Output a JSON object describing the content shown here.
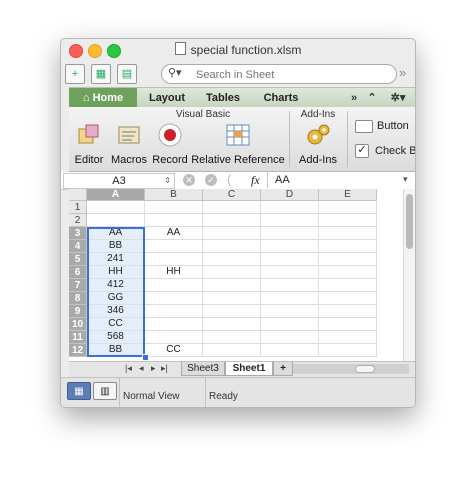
{
  "window": {
    "title": "special function.xlsm"
  },
  "toolbar": {
    "search_placeholder": "Search in Sheet"
  },
  "tabs": [
    "Home",
    "Layout",
    "Tables",
    "Charts"
  ],
  "tabs_more": "»",
  "ribbon": {
    "group_vb": "Visual Basic",
    "group_addins": "Add-Ins",
    "editor": "Editor",
    "macros": "Macros",
    "record": "Record",
    "relative_reference": "Relative Reference",
    "add_ins": "Add-Ins",
    "button": "Button",
    "check_box": "Check Bo"
  },
  "formula_bar": {
    "name_box": "A3",
    "fx": "fx",
    "value": "AA"
  },
  "grid": {
    "columns": [
      "A",
      "B",
      "C",
      "D",
      "E"
    ],
    "rows": [
      [
        "",
        ""
      ],
      [
        "",
        ""
      ],
      [
        "AA",
        "AA"
      ],
      [
        "BB",
        ""
      ],
      [
        "241",
        ""
      ],
      [
        "HH",
        "HH"
      ],
      [
        "412",
        ""
      ],
      [
        "GG",
        ""
      ],
      [
        "346",
        ""
      ],
      [
        "CC",
        ""
      ],
      [
        "568",
        ""
      ],
      [
        "BB",
        "CC"
      ]
    ],
    "selected_column": "A",
    "selected_rows": [
      3,
      4,
      5,
      6,
      7,
      8,
      9,
      10,
      11,
      12
    ]
  },
  "sheets": [
    "Sheet3",
    "Sheet1"
  ],
  "active_sheet": "Sheet1",
  "status": {
    "view": "Normal View",
    "state": "Ready"
  },
  "colors": {
    "accent_green": "#6ea25c",
    "selection": "#3a6fd6",
    "record_red": "#d0202a"
  }
}
